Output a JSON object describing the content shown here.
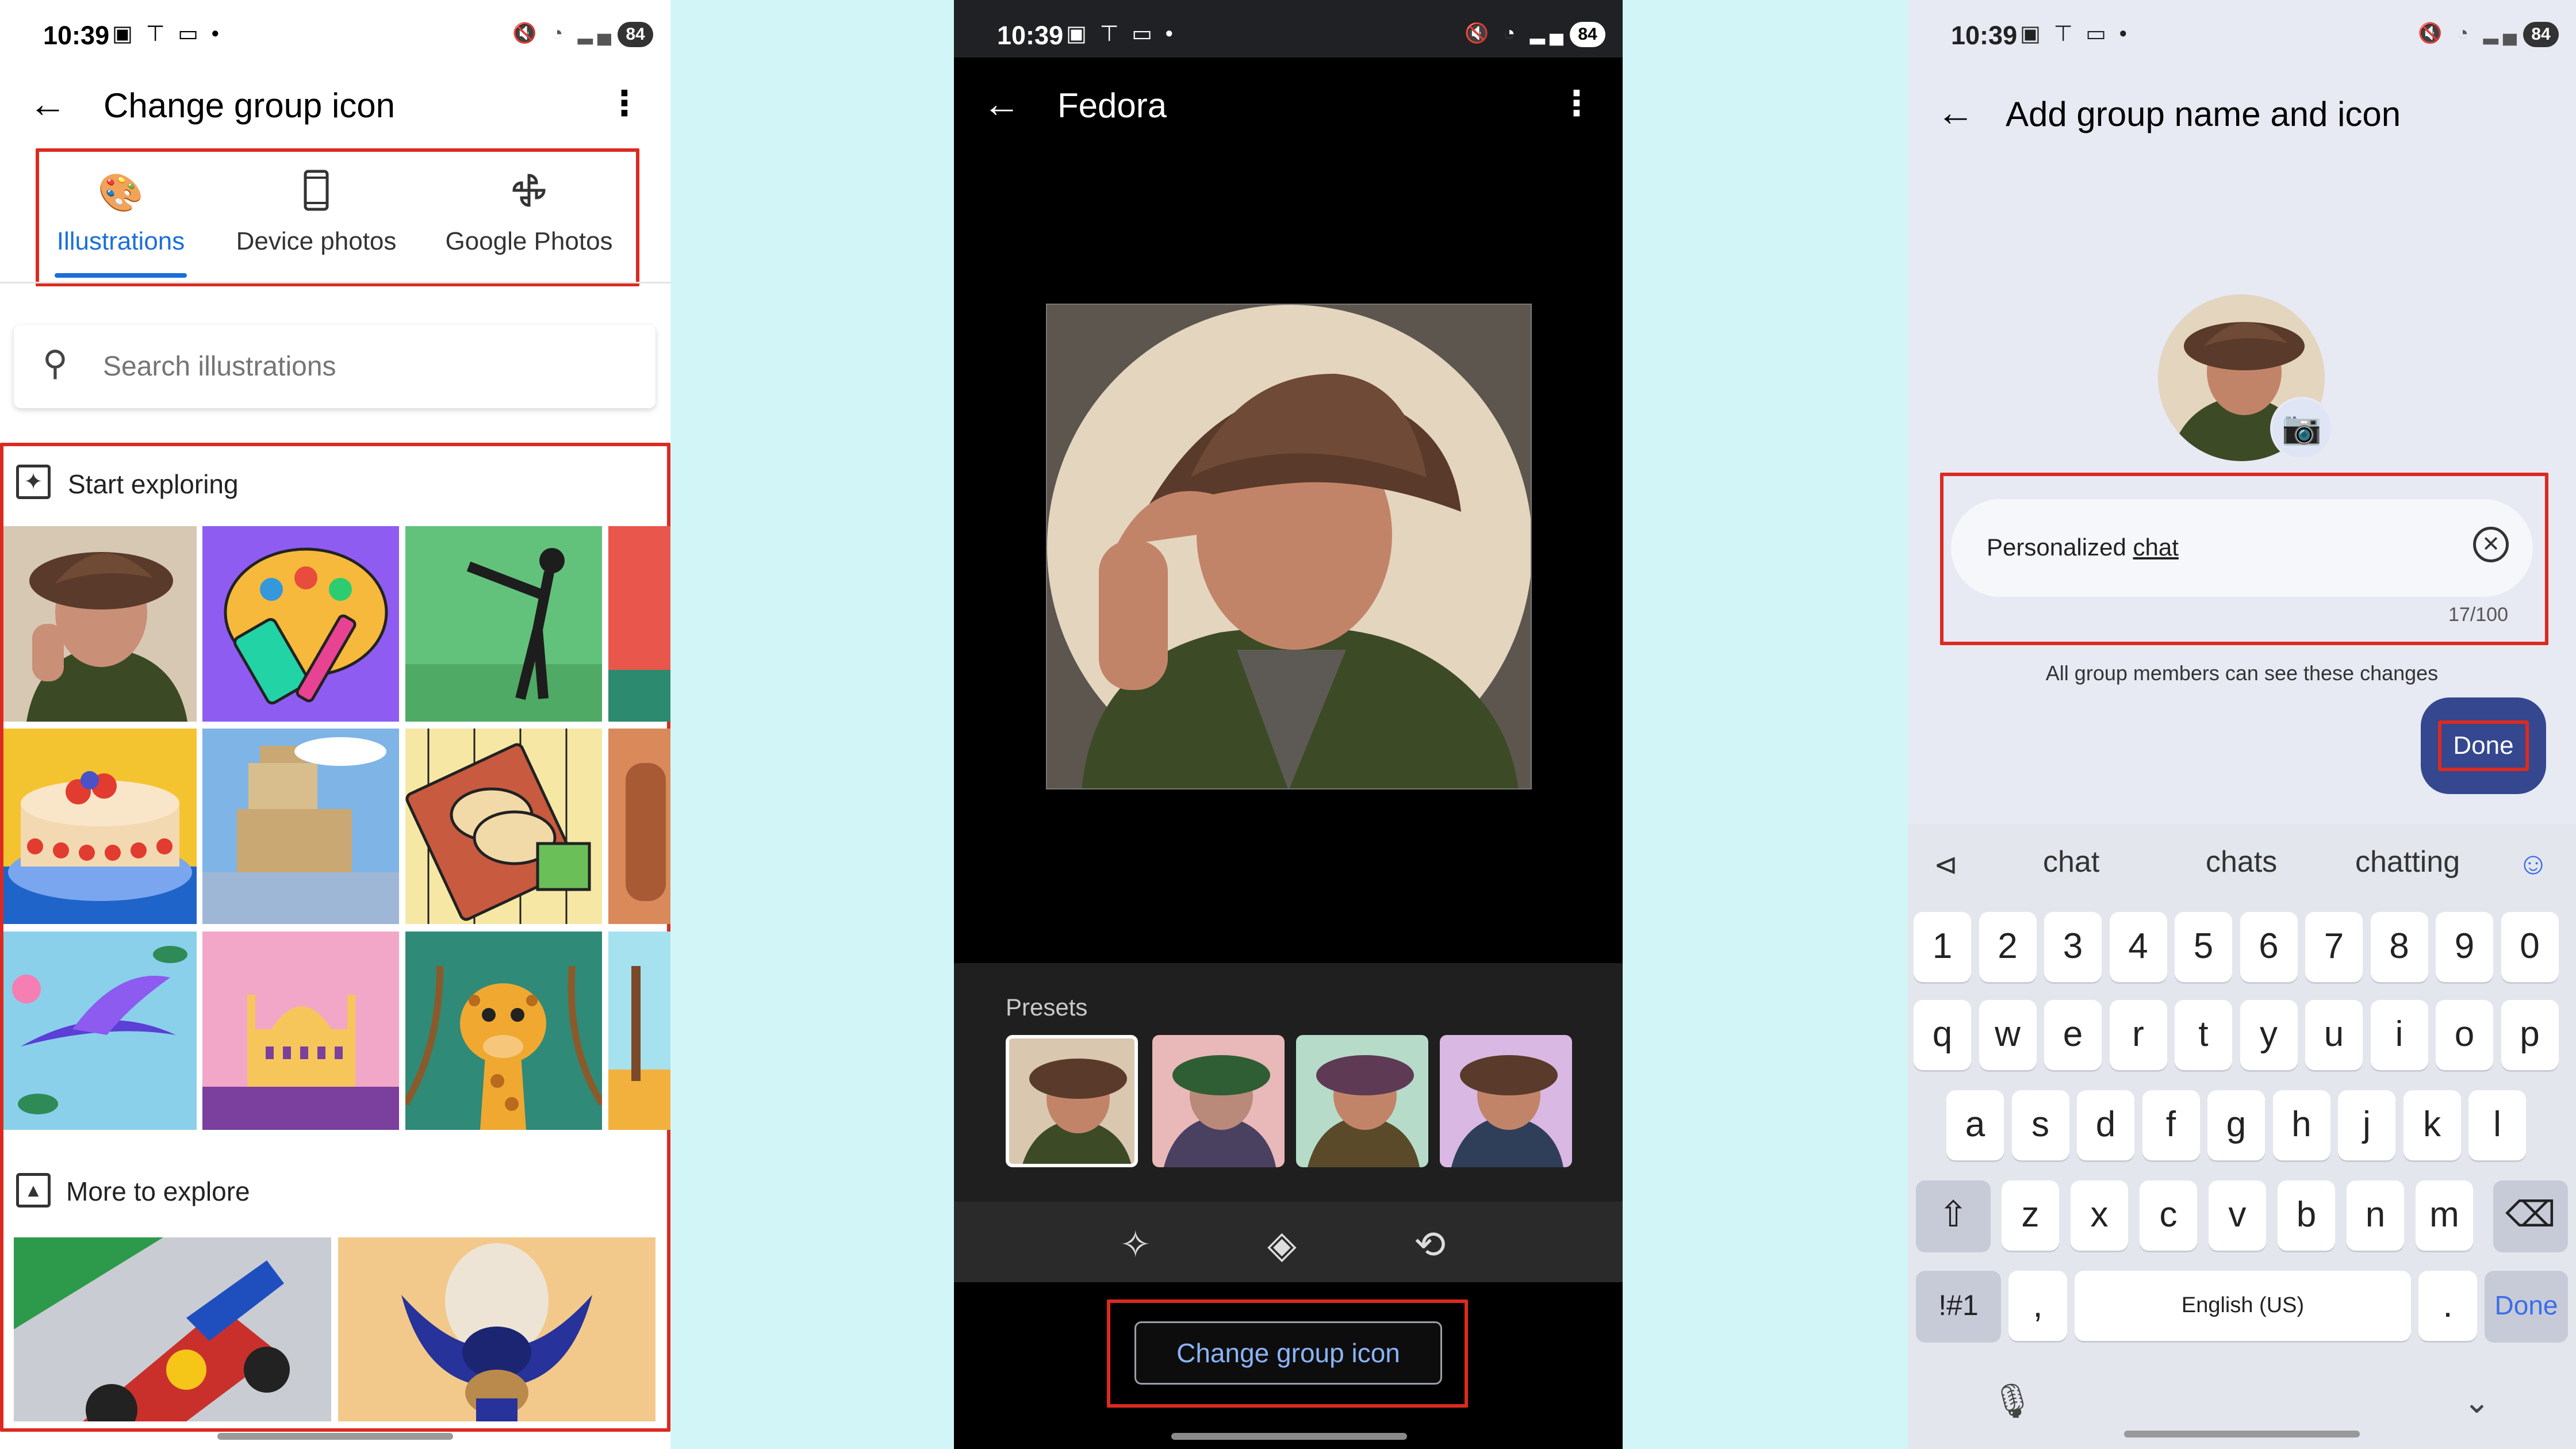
{
  "panel1": {
    "status": {
      "time": "10:39",
      "left_icons": "▣ ⊤ ▭ •",
      "right_icons": "🔇 ◔ ▂▄",
      "battery": "84"
    },
    "header": {
      "title": "Change group icon"
    },
    "tabs": [
      {
        "label": "Illustrations",
        "icon": "palette-icon",
        "active": true
      },
      {
        "label": "Device photos",
        "icon": "phone-icon",
        "active": false
      },
      {
        "label": "Google Photos",
        "icon": "pinwheel-icon",
        "active": false
      }
    ],
    "search": {
      "placeholder": "Search illustrations"
    },
    "sections": [
      {
        "title": "Start exploring",
        "icon": "sparkle-add-icon"
      },
      {
        "title": "More to explore",
        "icon": "gallery-icon"
      }
    ]
  },
  "panel2": {
    "status": {
      "time": "10:39",
      "left_icons": "▣ ⊤ ▭ •",
      "right_icons": "🔇 ◔ ▂▄",
      "battery": "84"
    },
    "header": {
      "title": "Fedora"
    },
    "presets": {
      "label": "Presets",
      "count_selected": 1
    },
    "tools": [
      "magic-wand-icon",
      "paint-bucket-icon",
      "crop-rotate-icon"
    ],
    "action_button": "Change group icon"
  },
  "panel3": {
    "status": {
      "time": "10:39",
      "left_icons": "▣ ⊤ ▭ •",
      "right_icons": "🔇 ◔ ▂▄",
      "battery": "84"
    },
    "header": {
      "title": "Add group name and icon"
    },
    "name_field": {
      "value_plain": "Personalized ",
      "value_underlined": "chat",
      "counter": "17/100"
    },
    "hint": "All group members can see these changes",
    "done_button": "Done",
    "suggestions": [
      "chat",
      "chats",
      "chatting"
    ],
    "keyboard": {
      "row_numbers": [
        "1",
        "2",
        "3",
        "4",
        "5",
        "6",
        "7",
        "8",
        "9",
        "0"
      ],
      "row_q": [
        "q",
        "w",
        "e",
        "r",
        "t",
        "y",
        "u",
        "i",
        "o",
        "p"
      ],
      "row_a": [
        "a",
        "s",
        "d",
        "f",
        "g",
        "h",
        "j",
        "k",
        "l"
      ],
      "row_z": [
        "z",
        "x",
        "c",
        "v",
        "b",
        "n",
        "m"
      ],
      "symbols_key": "!#1",
      "comma_key": ",",
      "space_label": "English (US)",
      "period_key": ".",
      "done_key": "Done"
    }
  },
  "colors": {
    "accent_blue": "#1a6fd8",
    "highlight_red": "#dc2a20",
    "background_cyan": "#d2f6f7",
    "done_navy": "#34478f"
  }
}
